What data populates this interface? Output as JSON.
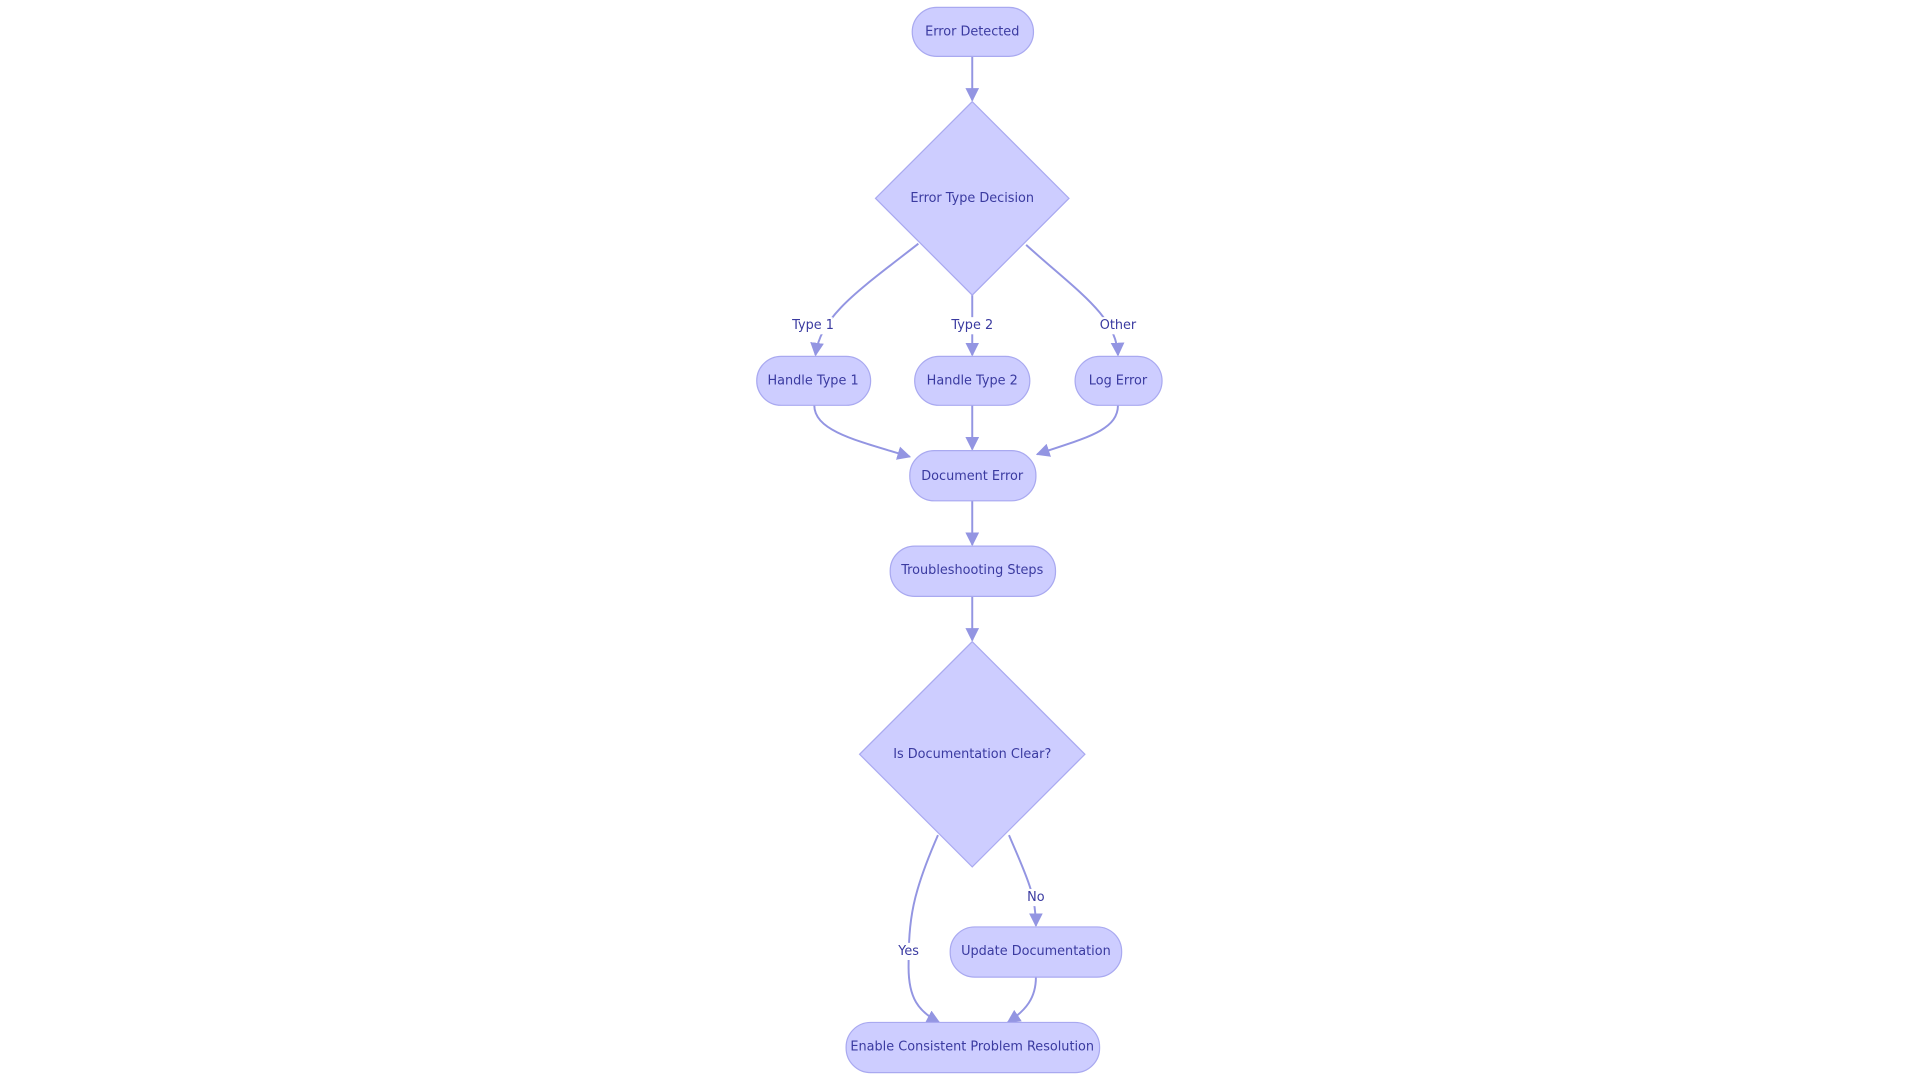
{
  "diagram": {
    "type": "flowchart",
    "colors": {
      "node_fill": "#CDCDFF",
      "node_stroke": "#A9A9F0",
      "edge": "#9395E2",
      "text": "#3A3AA0"
    },
    "nodes": {
      "error_detected": "Error Detected",
      "error_type_decision": "Error Type Decision",
      "handle_type1": "Handle Type 1",
      "handle_type2": "Handle Type 2",
      "log_error": "Log Error",
      "document_error": "Document Error",
      "troubleshooting_steps": "Troubleshooting Steps",
      "is_doc_clear": "Is Documentation Clear?",
      "update_documentation": "Update Documentation",
      "enable_resolution": "Enable Consistent Problem Resolution"
    },
    "edge_labels": {
      "type1": "Type 1",
      "type2": "Type 2",
      "other": "Other",
      "yes": "Yes",
      "no": "No"
    }
  }
}
